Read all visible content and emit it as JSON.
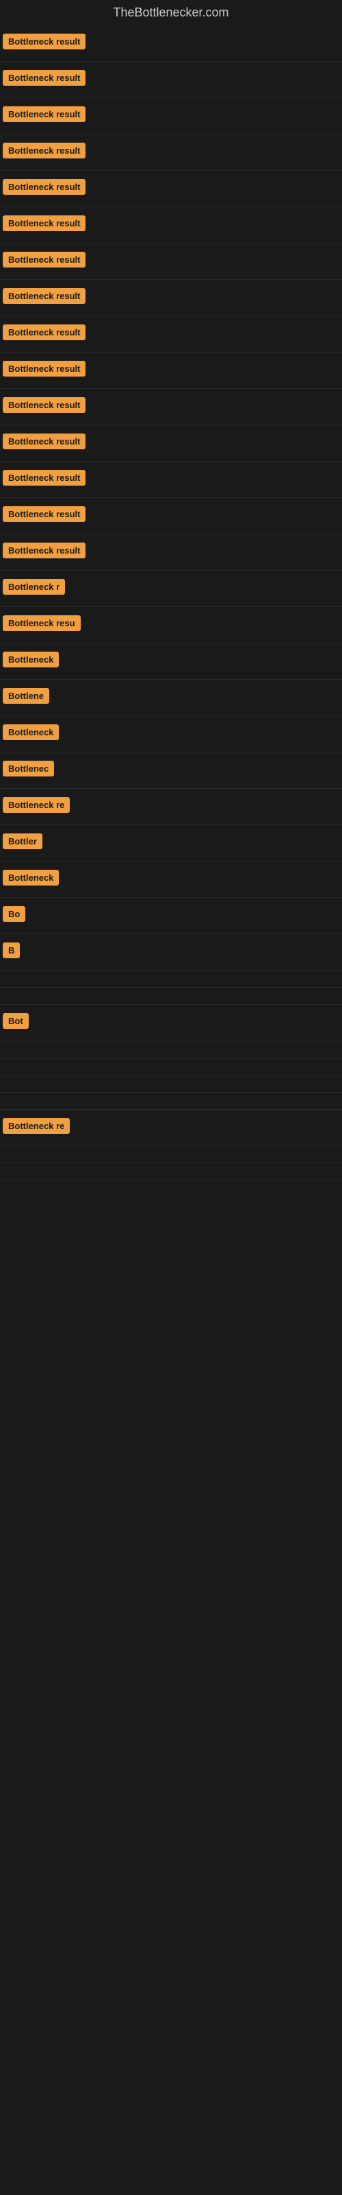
{
  "site": {
    "title": "TheBottlenecker.com"
  },
  "rows": [
    {
      "id": 1,
      "label": "Bottleneck result",
      "truncated": false
    },
    {
      "id": 2,
      "label": "Bottleneck result",
      "truncated": false
    },
    {
      "id": 3,
      "label": "Bottleneck result",
      "truncated": false
    },
    {
      "id": 4,
      "label": "Bottleneck result",
      "truncated": false
    },
    {
      "id": 5,
      "label": "Bottleneck result",
      "truncated": false
    },
    {
      "id": 6,
      "label": "Bottleneck result",
      "truncated": false
    },
    {
      "id": 7,
      "label": "Bottleneck result",
      "truncated": false
    },
    {
      "id": 8,
      "label": "Bottleneck result",
      "truncated": false
    },
    {
      "id": 9,
      "label": "Bottleneck result",
      "truncated": false
    },
    {
      "id": 10,
      "label": "Bottleneck result",
      "truncated": false
    },
    {
      "id": 11,
      "label": "Bottleneck result",
      "truncated": false
    },
    {
      "id": 12,
      "label": "Bottleneck result",
      "truncated": false
    },
    {
      "id": 13,
      "label": "Bottleneck result",
      "truncated": false
    },
    {
      "id": 14,
      "label": "Bottleneck result",
      "truncated": false
    },
    {
      "id": 15,
      "label": "Bottleneck result",
      "truncated": false
    },
    {
      "id": 16,
      "label": "Bottleneck r",
      "truncated": true
    },
    {
      "id": 17,
      "label": "Bottleneck resu",
      "truncated": true
    },
    {
      "id": 18,
      "label": "Bottleneck",
      "truncated": true
    },
    {
      "id": 19,
      "label": "Bottlene",
      "truncated": true
    },
    {
      "id": 20,
      "label": "Bottleneck",
      "truncated": true
    },
    {
      "id": 21,
      "label": "Bottlenec",
      "truncated": true
    },
    {
      "id": 22,
      "label": "Bottleneck re",
      "truncated": true
    },
    {
      "id": 23,
      "label": "Bottler",
      "truncated": true
    },
    {
      "id": 24,
      "label": "Bottleneck",
      "truncated": true
    },
    {
      "id": 25,
      "label": "Bo",
      "truncated": true
    },
    {
      "id": 26,
      "label": "B",
      "truncated": true
    },
    {
      "id": 27,
      "label": "",
      "truncated": true
    },
    {
      "id": 28,
      "label": "",
      "truncated": true
    },
    {
      "id": 29,
      "label": "Bot",
      "truncated": true
    },
    {
      "id": 30,
      "label": "",
      "truncated": true
    },
    {
      "id": 31,
      "label": "",
      "truncated": true
    },
    {
      "id": 32,
      "label": "",
      "truncated": true
    },
    {
      "id": 33,
      "label": "",
      "truncated": true
    },
    {
      "id": 34,
      "label": "Bottleneck re",
      "truncated": true
    },
    {
      "id": 35,
      "label": "",
      "truncated": true
    },
    {
      "id": 36,
      "label": "",
      "truncated": true
    }
  ]
}
